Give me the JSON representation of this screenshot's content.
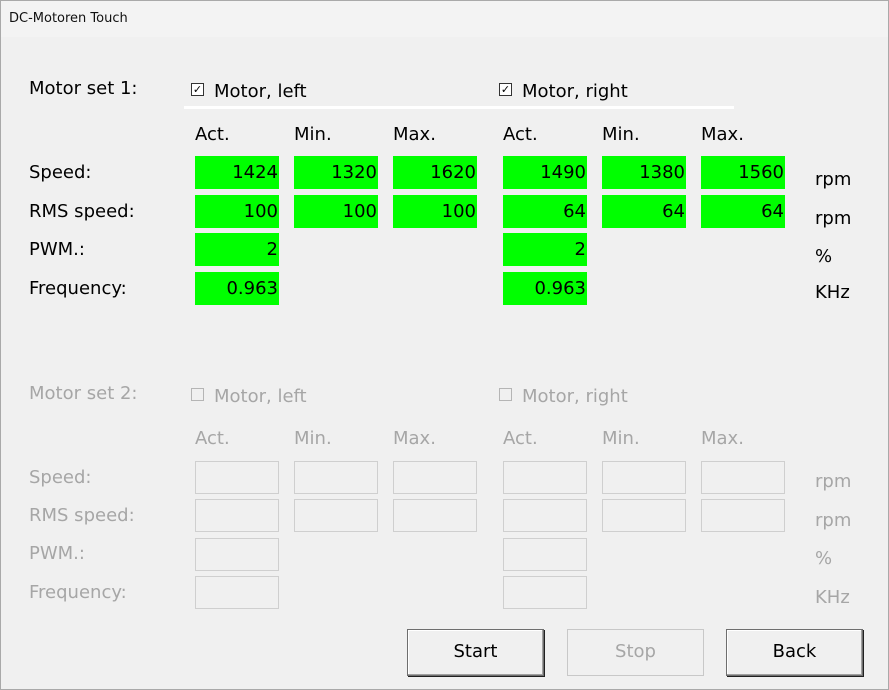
{
  "window": {
    "title": "DC-Motoren Touch"
  },
  "set1": {
    "label": "Motor set 1:",
    "left_check_label": "Motor, left",
    "right_check_label": "Motor, right",
    "left_checked": true,
    "right_checked": true,
    "headers": {
      "act": "Act.",
      "min": "Min.",
      "max": "Max."
    },
    "rows": {
      "speed": "Speed:",
      "rms": "RMS speed:",
      "pwm": "PWM.:",
      "freq": "Frequency:"
    },
    "units": {
      "speed": "rpm",
      "rms": "rpm",
      "pwm": "%",
      "freq": "KHz"
    },
    "left": {
      "speed_act": "1424",
      "speed_min": "1320",
      "speed_max": "1620",
      "rms_act": "100",
      "rms_min": "100",
      "rms_max": "100",
      "pwm_act": "2",
      "freq_act": "0.963"
    },
    "right": {
      "speed_act": "1490",
      "speed_min": "1380",
      "speed_max": "1560",
      "rms_act": "64",
      "rms_min": "64",
      "rms_max": "64",
      "pwm_act": "2",
      "freq_act": "0.963"
    },
    "active_color": "#00ff00"
  },
  "set2": {
    "label": "Motor set 2:",
    "left_check_label": "Motor, left",
    "right_check_label": "Motor, right",
    "left_checked": false,
    "right_checked": false,
    "headers": {
      "act": "Act.",
      "min": "Min.",
      "max": "Max."
    },
    "rows": {
      "speed": "Speed:",
      "rms": "RMS speed:",
      "pwm": "PWM.:",
      "freq": "Frequency:"
    },
    "units": {
      "speed": "rpm",
      "rms": "rpm",
      "pwm": "%",
      "freq": "KHz"
    },
    "disabled_color": "#a6a6a6"
  },
  "buttons": {
    "start": "Start",
    "stop": "Stop",
    "back": "Back"
  }
}
